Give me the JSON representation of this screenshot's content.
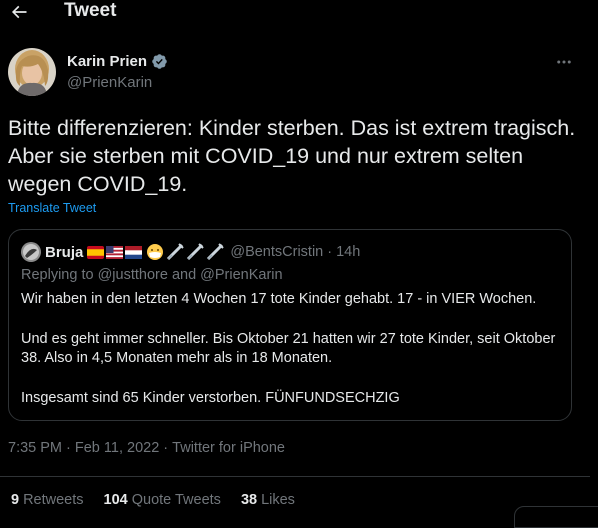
{
  "header": {
    "title": "Tweet"
  },
  "author": {
    "name": "Karin Prien",
    "handle": "@PrienKarin"
  },
  "tweet": {
    "text": "Bitte differenzieren: Kinder sterben. Das ist extrem tragisch. Aber sie sterben mit COVID_19 und nur extrem selten wegen COVID_19.",
    "translate_label": "Translate Tweet"
  },
  "quote": {
    "name": "Bruja",
    "handle": "@BentsCristin",
    "separator": "·",
    "time": "14h",
    "replying_prefix": "Replying to ",
    "replying_mentions": "@justthore and @PrienKarin",
    "paragraphs": [
      "Wir haben in den letzten 4 Wochen 17 tote Kinder gehabt. 17 - in VIER Wochen.",
      "Und es geht immer schneller. Bis Oktober 21 hatten wir 27 tote Kinder, seit Oktober 38. Also in 4,5 Monaten mehr als in 18 Monaten.",
      "Insgesamt sind 65 Kinder verstorben. FÜNFUNDSECHZIG"
    ],
    "emoji_icons": [
      "spain-flag-icon",
      "usa-flag-icon",
      "netherlands-flag-icon",
      "mask-face-icon",
      "syringe-icon",
      "syringe-icon",
      "syringe-icon"
    ]
  },
  "meta": {
    "time": "7:35 PM",
    "sep1": " · ",
    "date": "Feb 11, 2022",
    "sep2": " · ",
    "source": "Twitter for iPhone"
  },
  "stats": {
    "retweets_count": "9",
    "retweets_label": "Retweets",
    "quotes_count": "104",
    "quotes_label": "Quote Tweets",
    "likes_count": "38",
    "likes_label": "Likes"
  },
  "colors": {
    "background": "#000000",
    "text": "#e7e9ea",
    "secondary": "#71767b",
    "link": "#1d9bf0",
    "border": "#2f3336",
    "verified": "#829aab"
  }
}
